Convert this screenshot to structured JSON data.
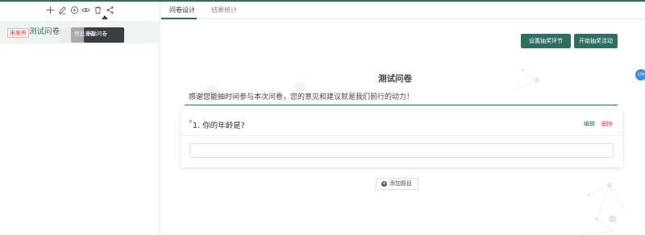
{
  "sidebar": {
    "toolbar": {
      "add_icon": "plus-icon",
      "edit_icon": "pencil-icon",
      "publish_icon": "circle-play-icon",
      "preview_icon": "eye-icon",
      "delete_icon": "trash-icon",
      "share_icon": "share-icon"
    },
    "survey": {
      "status_badge": "未发布",
      "name": "测试问卷",
      "action_pills": [
        "预览问卷",
        "删除问卷"
      ],
      "tooltip": "删除问卷"
    }
  },
  "main": {
    "tabs": [
      "问卷设计",
      "结果统计"
    ],
    "active_tab": "问卷设计",
    "buttons": {
      "prize_setting": "设置抽奖环节",
      "start_lottery": "开始抽奖活动"
    },
    "side_dot_label": "STM",
    "survey_title": "测试问卷",
    "survey_intro": "感谢您能抽时间参与本次问卷，您的意见和建议就是我们前行的动力！",
    "question": {
      "required_mark": "*",
      "title": "1. 你的年龄是?",
      "edit_label": "编辑",
      "delete_label": "删除",
      "answer_value": ""
    },
    "add_question_label": "添加题目"
  },
  "colors": {
    "primary": "#2f6f62",
    "danger": "#d64545",
    "tooltip": "#3a3d40",
    "dot": "#3c8dde"
  }
}
